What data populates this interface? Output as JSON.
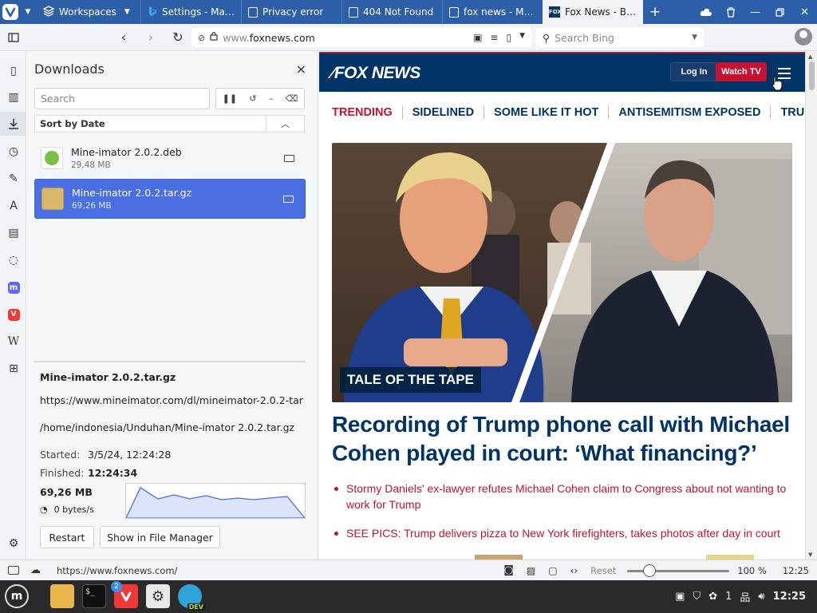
{
  "tabbar": {
    "workspaces_label": "Workspaces",
    "tabs": [
      {
        "label": "Settings - Man...",
        "active": false
      },
      {
        "label": "Privacy error",
        "active": false
      },
      {
        "label": "404 Not Found",
        "active": false
      },
      {
        "label": "fox news - Men...",
        "active": false
      },
      {
        "label": "Fox News - Break",
        "active": true
      }
    ],
    "new_tab": "+"
  },
  "address": {
    "url_prefix": "www.",
    "url_domain": "foxnews.com",
    "search_placeholder": "Search Bing"
  },
  "downloads": {
    "title": "Downloads",
    "close": "×",
    "search_placeholder": "Search",
    "sort_label": "Sort by Date",
    "items": [
      {
        "name": "Mine-imator 2.0.2.deb",
        "size": "29,48 MB",
        "selected": false
      },
      {
        "name": "Mine-imator 2.0.2.tar.gz",
        "size": "69,26 MB",
        "selected": true
      }
    ],
    "details": {
      "filename": "Mine-imator 2.0.2.tar.gz",
      "source_url": "https://www.mineimator.com/dl/mineimator-2.0.2-tar",
      "path": "/home/indonesia/Unduhan/Mine-imator 2.0.2.tar.gz",
      "started_label": "Started:",
      "started_value": "3/5/24, 12:24:28",
      "finished_label": "Finished:",
      "finished_value": "12:24:34",
      "total_size": "69,26 MB",
      "speed": "0 bytes/s"
    },
    "buttons": {
      "restart": "Restart",
      "show_in_manager": "Show in File Manager"
    }
  },
  "page": {
    "logo": "FOX NEWS",
    "login": "Log In",
    "watch_tv": "Watch TV",
    "trending_label": "TRENDING",
    "trending": [
      "SIDELINED",
      "SOME LIKE IT HOT",
      "ANTISEMITISM EXPOSED",
      "TRUE CRIME"
    ],
    "hero_badge": "TALE OF THE TAPE",
    "headline": "Recording of Trump phone call with Michael Cohen played in court: ‘What financing?’",
    "bullets": [
      "Stormy Daniels' ex-lawyer refutes Michael Cohen claim to Congress about not wanting to work for Trump",
      "SEE PICS: Trump delivers pizza to New York firefighters, takes photos after day in court"
    ]
  },
  "status": {
    "url": "https://www.foxnews.com/",
    "reset": "Reset",
    "zoom": "100 %",
    "zoom_level": 0.18,
    "time": "12:25"
  },
  "taskbar": {
    "vivaldi_badge": "2",
    "edge_badge": "DEV",
    "tray_workspace": "1",
    "clock": "12:25"
  },
  "colors": {
    "tabbar": "#2d5ea8",
    "fox_navy": "#003366",
    "fox_red": "#c41230",
    "download_selected": "#4a6fe3"
  }
}
